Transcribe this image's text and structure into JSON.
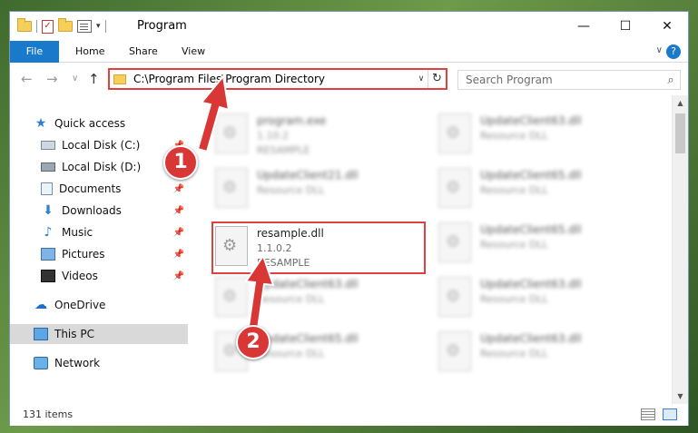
{
  "window": {
    "title": "Program",
    "controls": {
      "minimize": "—",
      "maximize": "☐",
      "close": "✕"
    }
  },
  "quick_access_toolbar": {
    "arrow": "▾"
  },
  "ribbon": {
    "tabs": [
      "File",
      "Home",
      "Share",
      "View"
    ],
    "expand": "∨",
    "help": "?"
  },
  "nav": {
    "back": "←",
    "forward": "→",
    "recent": "∨",
    "up": "↑"
  },
  "address": {
    "path": "C:\\Program Files\\Program Directory",
    "dropdown": "∨",
    "refresh": "↻"
  },
  "search": {
    "placeholder": "Search Program",
    "icon": "⌕"
  },
  "navpane": {
    "items": [
      {
        "label": "Quick access",
        "icon": "star-icon",
        "pinned": false
      },
      {
        "label": "Local Disk (C:)",
        "icon": "drive-icon",
        "pinned": true
      },
      {
        "label": "Local Disk (D:)",
        "icon": "drive-icon",
        "pinned": true
      },
      {
        "label": "Documents",
        "icon": "documents-icon",
        "pinned": true
      },
      {
        "label": "Downloads",
        "icon": "downloads-icon",
        "pinned": true
      },
      {
        "label": "Music",
        "icon": "music-icon",
        "pinned": true
      },
      {
        "label": "Pictures",
        "icon": "pictures-icon",
        "pinned": true
      },
      {
        "label": "Videos",
        "icon": "videos-icon",
        "pinned": true
      },
      {
        "label": "OneDrive",
        "icon": "onedrive-icon",
        "pinned": false
      },
      {
        "label": "This PC",
        "icon": "this-pc-icon",
        "pinned": false,
        "selected": true
      },
      {
        "label": "Network",
        "icon": "network-icon",
        "pinned": false
      }
    ],
    "pin_glyph": "📌"
  },
  "files": [
    {
      "name": "program.exe",
      "line2": "1.10.2",
      "line3": "RESAMPLE",
      "blurred": true
    },
    {
      "name": "UpdateClient63.dll",
      "line2": "Resource DLL",
      "line3": "",
      "blurred": true
    },
    {
      "name": "UpdateClient21.dll",
      "line2": "Resource DLL",
      "line3": "",
      "blurred": true
    },
    {
      "name": "UpdateClient65.dll",
      "line2": "Resource DLL",
      "line3": "",
      "blurred": true
    },
    {
      "name": "resample.dll",
      "line2": "1.1.0.2",
      "line3": "RESAMPLE",
      "blurred": false
    },
    {
      "name": "UpdateClient65.dll",
      "line2": "Resource DLL",
      "line3": "",
      "blurred": true
    },
    {
      "name": "UpdateClient63.dll",
      "line2": "Resource DLL",
      "line3": "",
      "blurred": true
    },
    {
      "name": "UpdateClient63.dll",
      "line2": "Resource DLL",
      "line3": "",
      "blurred": true
    },
    {
      "name": "UpdateClient65.dll",
      "line2": "Resource DLL",
      "line3": "",
      "blurred": true
    },
    {
      "name": "UpdateClient63.dll",
      "line2": "Resource DLL",
      "line3": "",
      "blurred": true
    }
  ],
  "status": {
    "count": "131 items"
  },
  "scrollbar": {
    "up": "▲",
    "down": "▼"
  },
  "annotations": {
    "step1": "1",
    "step2": "2",
    "accent": "#d93636"
  }
}
